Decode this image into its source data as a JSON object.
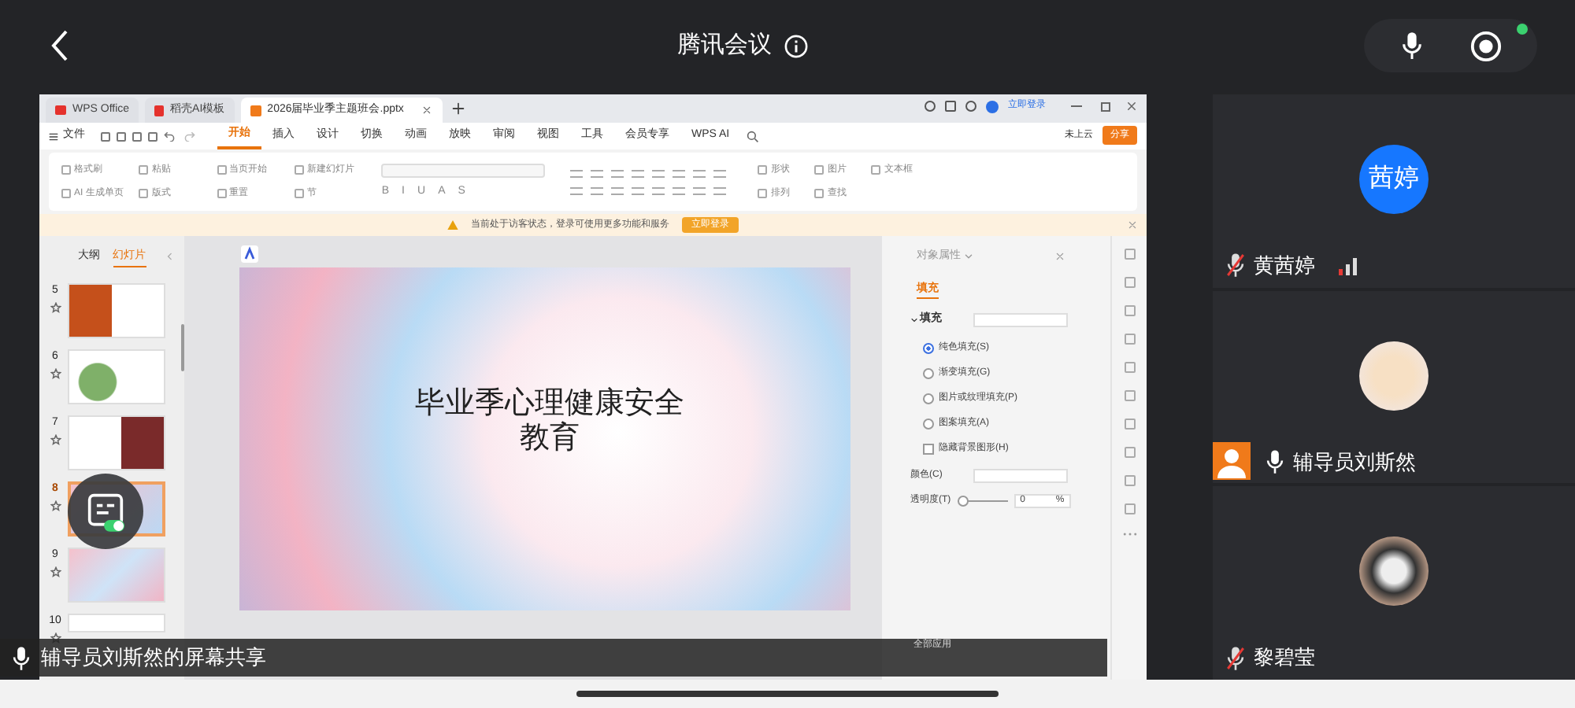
{
  "header": {
    "title": "腾讯会议"
  },
  "share": {
    "window_tabs": [
      {
        "label": "WPS Office",
        "selected": false
      },
      {
        "label": "稻壳AI模板",
        "selected": false
      },
      {
        "label": "2026届毕业季主题班会.pptx",
        "selected": true
      }
    ],
    "account": "立即登录",
    "file_menu": "文件",
    "menu_tabs": [
      {
        "label": "开始",
        "selected": true
      },
      {
        "label": "插入",
        "selected": false
      },
      {
        "label": "设计",
        "selected": false
      },
      {
        "label": "切换",
        "selected": false
      },
      {
        "label": "动画",
        "selected": false
      },
      {
        "label": "放映",
        "selected": false
      },
      {
        "label": "审阅",
        "selected": false
      },
      {
        "label": "视图",
        "selected": false
      },
      {
        "label": "工具",
        "selected": false
      },
      {
        "label": "会员专享",
        "selected": false
      },
      {
        "label": "WPS AI",
        "selected": false
      }
    ],
    "cloud": "未上云",
    "share_button": "分享",
    "ribbon_left": [
      {
        "label": "格式刷"
      },
      {
        "label": "粘贴"
      },
      {
        "label": "当页开始"
      },
      {
        "label": "新建幻灯片"
      },
      {
        "label": "AI 生成单页"
      },
      {
        "label": "版式"
      },
      {
        "label": "重置"
      },
      {
        "label": "节"
      }
    ],
    "format_buttons": [
      "B",
      "I",
      "U",
      "A",
      "S"
    ],
    "ribbon_right": [
      {
        "label": "形状"
      },
      {
        "label": "图片"
      },
      {
        "label": "文本框"
      },
      {
        "label": "排列"
      },
      {
        "label": "查找"
      }
    ],
    "notice": {
      "text": "当前处于访客状态，登录可使用更多功能和服务",
      "button": "立即登录"
    },
    "panel_tabs": [
      {
        "label": "大纲",
        "selected": false
      },
      {
        "label": "幻灯片",
        "selected": true
      }
    ],
    "slides": [
      {
        "number": "5",
        "selected": false
      },
      {
        "number": "6",
        "selected": false
      },
      {
        "number": "7",
        "selected": false
      },
      {
        "number": "8",
        "selected": true
      },
      {
        "number": "9",
        "selected": false
      },
      {
        "number": "10",
        "selected": false
      }
    ],
    "slide": {
      "title": "毕业季心理健康安全教育"
    },
    "properties": {
      "title": "对象属性",
      "tab": "填充",
      "section": "填充",
      "fill_options": [
        {
          "label": "纯色填充(S)",
          "selected": true
        },
        {
          "label": "渐变填充(G)",
          "selected": false
        },
        {
          "label": "图片或纹理填充(P)",
          "selected": false
        },
        {
          "label": "图案填充(A)",
          "selected": false
        }
      ],
      "hide_background": {
        "label": "隐藏背景图形(H)",
        "checked": false
      },
      "color_label": "颜色(C)",
      "transparency": {
        "label": "透明度(T)",
        "level": 0,
        "value": "0",
        "unit": "%"
      },
      "apply_all": "全部应用"
    },
    "share_label": "辅导员刘斯然的屏幕共享"
  },
  "participants": [
    {
      "name": "黄茜婷",
      "kind": "initials",
      "avatar_text": "茜婷",
      "muted": true,
      "sharing": false
    },
    {
      "name": "辅导员刘斯然",
      "kind": "photo",
      "muted": false,
      "sharing": true
    },
    {
      "name": "黎碧莹",
      "kind": "photo",
      "muted": true,
      "sharing": false
    }
  ]
}
